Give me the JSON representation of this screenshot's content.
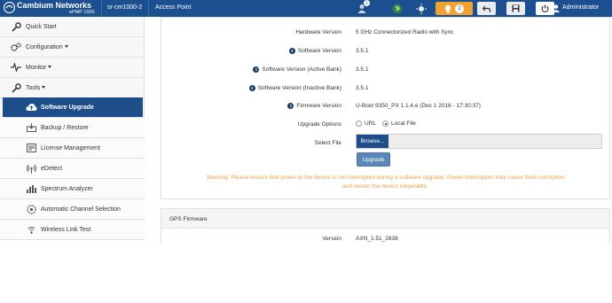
{
  "header": {
    "brand": "Cambium Networks",
    "model": "ePMP 1000",
    "device_name": "sr-cm1000-2",
    "mode": "Access Point",
    "notification_badge": "1",
    "alert_count": "2",
    "user": "Administrator",
    "colors": {
      "bar": "#1b4f8f",
      "alert": "#f0a330"
    },
    "icons": [
      "user-notification-icon",
      "globe-icon",
      "sun-icon",
      "undo-icon",
      "save-icon",
      "power-icon",
      "user-icon"
    ]
  },
  "sidebar": {
    "items": [
      {
        "label": "Quick Start",
        "icon": "wrench-icon"
      },
      {
        "label": "Configuration",
        "icon": "gears-icon"
      },
      {
        "label": "Monitor",
        "icon": "pulse-icon"
      },
      {
        "label": "Tools",
        "icon": "wrench-icon"
      }
    ],
    "tools_sub": [
      {
        "label": "Software Upgrade",
        "icon": "upgrade-icon",
        "active": true
      },
      {
        "label": "Backup / Restore",
        "icon": "backup-icon"
      },
      {
        "label": "License Management",
        "icon": "license-icon"
      },
      {
        "label": "eDetect",
        "icon": "signal-icon"
      },
      {
        "label": "Spectrum Analyzer",
        "icon": "bars-icon"
      },
      {
        "label": "Automatic Channel Selection",
        "icon": "channel-icon"
      },
      {
        "label": "Wireless Link Test",
        "icon": "link-test-icon"
      }
    ]
  },
  "software": {
    "rows": [
      {
        "label": "Hardware Version",
        "value": "5 GHz Connectorized Radio with Sync"
      },
      {
        "label": "Software Version",
        "value": "3.5.1"
      },
      {
        "label": "Software Version (Active Bank)",
        "value": "3.5.1"
      },
      {
        "label": "Software Version (Inactive Bank)",
        "value": "3.5.1"
      },
      {
        "label": "Firmware Version",
        "value": "U-Boot 9350_PX 1.1.4.e (Dec 1 2016 - 17:30:37)"
      }
    ],
    "upgrade_options_label": "Upgrade Options",
    "option_url": "URL",
    "option_local": "Local File",
    "select_file_label": "Select File",
    "browse_label": "Browse...",
    "upgrade_label": "Upgrade",
    "warning": "Warning: Please ensure that power to the device is not interrupted during a software upgrade. Power interruption may cause flash corruption and render the device inoperable."
  },
  "gps": {
    "title": "GPS Firmware",
    "version_label": "Version",
    "version_value": "AXN_1.51_2838"
  }
}
